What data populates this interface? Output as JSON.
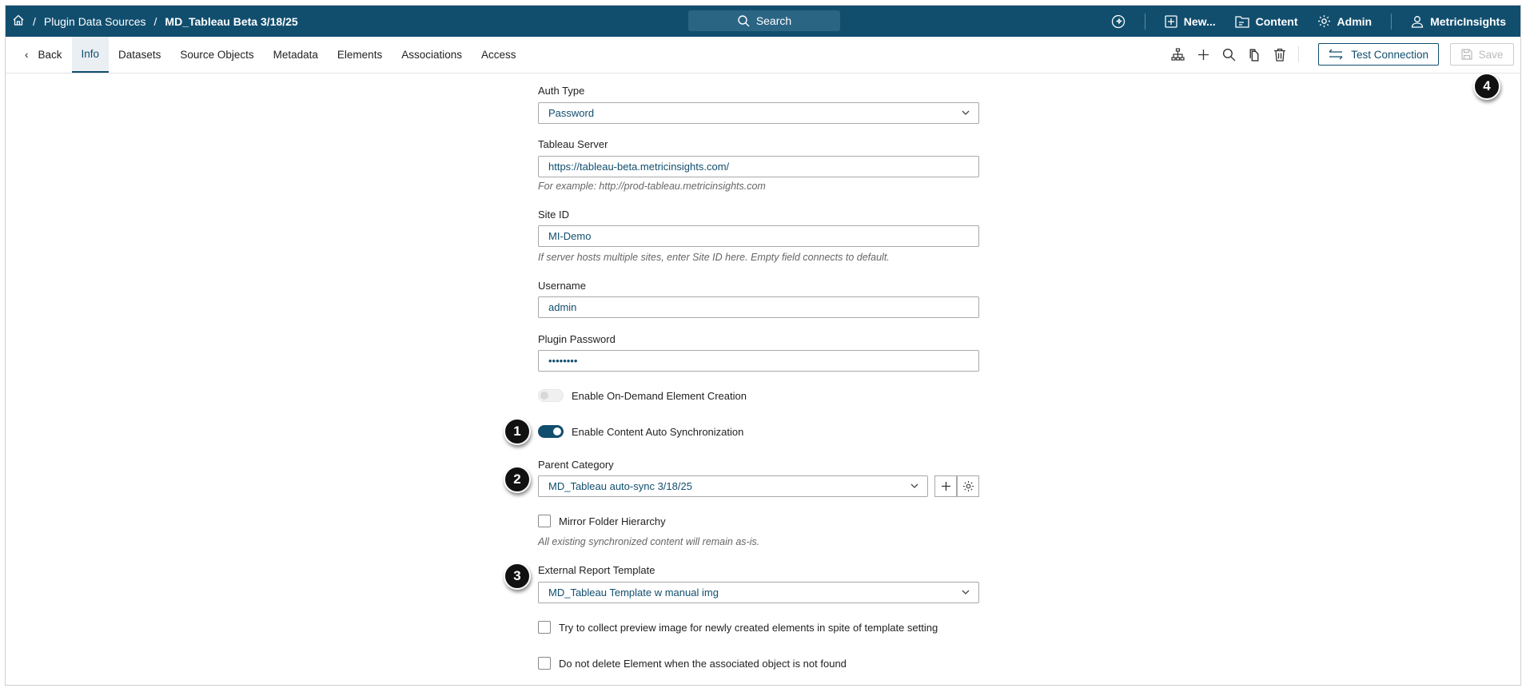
{
  "header": {
    "breadcrumb": [
      "Plugin Data Sources",
      "MD_Tableau Beta 3/18/25"
    ],
    "separator": "/",
    "search_label": "Search",
    "new_label": "New...",
    "content_label": "Content",
    "admin_label": "Admin",
    "user_label": "MetricInsights"
  },
  "toolbar": {
    "back_label": "Back",
    "tabs": [
      "Info",
      "Datasets",
      "Source Objects",
      "Metadata",
      "Elements",
      "Associations",
      "Access"
    ],
    "test_connection_label": "Test Connection",
    "save_label": "Save"
  },
  "form": {
    "auth_type": {
      "label": "Auth Type",
      "value": "Password"
    },
    "tableau_server": {
      "label": "Tableau Server",
      "value": "https://tableau-beta.metricinsights.com/",
      "hint": "For example: http://prod-tableau.metricinsights.com"
    },
    "site_id": {
      "label": "Site ID",
      "value": "MI-Demo",
      "hint": "If server hosts multiple sites, enter Site ID here. Empty field connects to default."
    },
    "username": {
      "label": "Username",
      "value": "admin"
    },
    "plugin_password": {
      "label": "Plugin Password",
      "value": "••••••••"
    },
    "on_demand": {
      "label": "Enable On-Demand Element Creation",
      "enabled": false
    },
    "auto_sync": {
      "label": "Enable Content Auto Synchronization",
      "enabled": true
    },
    "parent_category": {
      "label": "Parent Category",
      "value": "MD_Tableau auto-sync 3/18/25"
    },
    "mirror": {
      "label": "Mirror Folder Hierarchy",
      "checked": false,
      "hint": "All existing synchronized content will remain as-is."
    },
    "external_template": {
      "label": "External Report Template",
      "value": "MD_Tableau Template w manual img"
    },
    "collect_preview": {
      "label": "Try to collect preview image for newly created elements in spite of template setting",
      "checked": false
    },
    "no_delete": {
      "label": "Do not delete Element when the associated object is not found",
      "checked": false
    }
  },
  "badges": [
    "1",
    "2",
    "3",
    "4"
  ],
  "colors": {
    "brand": "#114e6e"
  }
}
